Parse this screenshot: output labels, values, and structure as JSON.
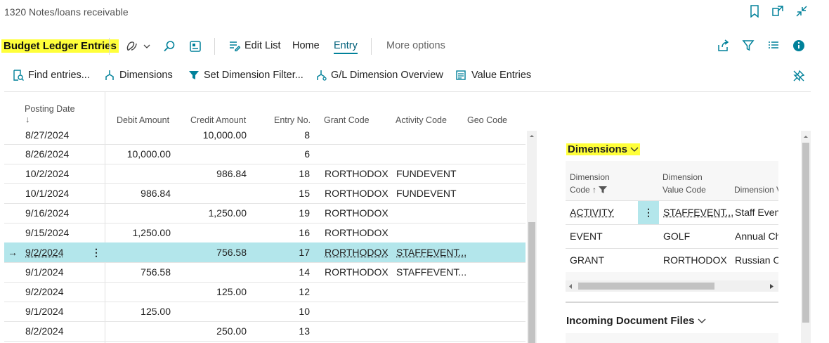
{
  "header": {
    "breadcrumb": "1320 Notes/loans receivable"
  },
  "actionbar": {
    "page_title": "Budget Ledger Entries",
    "edit_list": "Edit List",
    "home": "Home",
    "entry": "Entry",
    "more_options": "More options"
  },
  "subbar": {
    "find_entries": "Find entries...",
    "dimensions": "Dimensions",
    "set_dimension_filter": "Set Dimension Filter...",
    "gl_dimension_overview": "G/L Dimension Overview",
    "value_entries": "Value Entries"
  },
  "columns": {
    "posting_date": "Posting Date",
    "posting_date_sort": "↓",
    "debit_amount": "Debit Amount",
    "credit_amount": "Credit Amount",
    "entry_no": "Entry No.",
    "grant_code": "Grant Code",
    "activity_code": "Activity Code",
    "geo_code": "Geo Code"
  },
  "rows": [
    {
      "date": "8/27/2024",
      "debit": "",
      "credit": "10,000.00",
      "entry": "8",
      "grant": "",
      "activity": ""
    },
    {
      "date": "8/26/2024",
      "debit": "10,000.00",
      "credit": "",
      "entry": "6",
      "grant": "",
      "activity": ""
    },
    {
      "date": "10/2/2024",
      "debit": "",
      "credit": "986.84",
      "entry": "18",
      "grant": "RORTHODOX",
      "activity": "FUNDEVENT"
    },
    {
      "date": "10/1/2024",
      "debit": "986.84",
      "credit": "",
      "entry": "15",
      "grant": "RORTHODOX",
      "activity": "FUNDEVENT"
    },
    {
      "date": "9/16/2024",
      "debit": "",
      "credit": "1,250.00",
      "entry": "19",
      "grant": "RORTHODOX",
      "activity": ""
    },
    {
      "date": "9/15/2024",
      "debit": "1,250.00",
      "credit": "",
      "entry": "16",
      "grant": "RORTHODOX",
      "activity": ""
    },
    {
      "date": "9/2/2024",
      "debit": "",
      "credit": "756.58",
      "entry": "17",
      "grant": "RORTHODOX",
      "activity": "STAFFEVENT..."
    },
    {
      "date": "9/1/2024",
      "debit": "756.58",
      "credit": "",
      "entry": "14",
      "grant": "RORTHODOX",
      "activity": "STAFFEVENT..."
    },
    {
      "date": "9/2/2024",
      "debit": "",
      "credit": "125.00",
      "entry": "12",
      "grant": "",
      "activity": ""
    },
    {
      "date": "9/1/2024",
      "debit": "125.00",
      "credit": "",
      "entry": "10",
      "grant": "",
      "activity": ""
    },
    {
      "date": "8/2/2024",
      "debit": "",
      "credit": "250.00",
      "entry": "13",
      "grant": "",
      "activity": ""
    }
  ],
  "factbox": {
    "dimensions_title": "Dimensions",
    "dim_code_hdr1": "Dimension",
    "dim_code_hdr2": "Code ↑",
    "dim_value_hdr1": "Dimension",
    "dim_value_hdr2": "Value Code",
    "dim_name_hdr": "Dimension V",
    "rows": [
      {
        "code": "ACTIVITY",
        "value": "STAFFEVENT...",
        "name": "Staff Event"
      },
      {
        "code": "EVENT",
        "value": "GOLF",
        "name": "Annual Ch"
      },
      {
        "code": "GRANT",
        "value": "RORTHODOX",
        "name": "Russian O"
      }
    ],
    "incoming_title": "Incoming Document Files"
  },
  "colors": {
    "accent": "#00819a",
    "selected_row": "#b3e6eb",
    "highlight": "#ffff3a"
  }
}
